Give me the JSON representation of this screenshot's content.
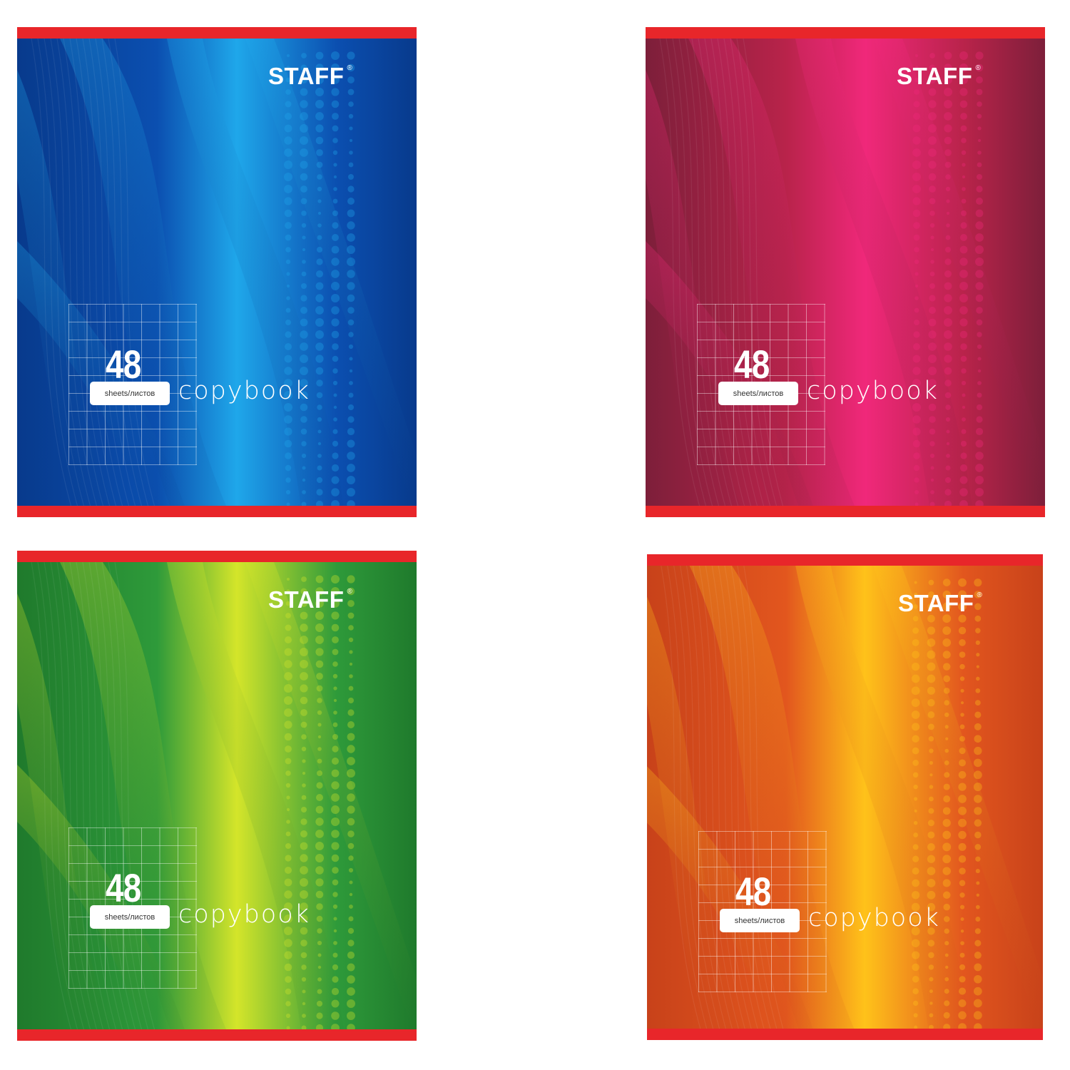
{
  "covers": [
    {
      "brand": "STAFF",
      "registered_mark": "®",
      "sheet_count": "48",
      "sheets_label": "sheets/листов",
      "product": "copybook",
      "colors": {
        "base": "#0b4fb0",
        "light": "#1fa7ea",
        "dark": "#083a8c",
        "band": "#e8262a"
      }
    },
    {
      "brand": "STAFF",
      "registered_mark": "®",
      "sheet_count": "48",
      "sheets_label": "sheets/листов",
      "product": "copybook",
      "colors": {
        "base": "#b8234a",
        "light": "#f0287a",
        "dark": "#7d1f3a",
        "band": "#e8262a"
      }
    },
    {
      "brand": "STAFF",
      "registered_mark": "®",
      "sheet_count": "48",
      "sheets_label": "sheets/листов",
      "product": "copybook",
      "colors": {
        "base": "#2e9a3a",
        "light": "#d4e52a",
        "dark": "#1f7a2c",
        "band": "#e8262a"
      }
    },
    {
      "brand": "STAFF",
      "registered_mark": "®",
      "sheet_count": "48",
      "sheets_label": "sheets/листов",
      "product": "copybook",
      "colors": {
        "base": "#e2561e",
        "light": "#ffc21a",
        "dark": "#c8421a",
        "band": "#e8262a"
      }
    }
  ]
}
